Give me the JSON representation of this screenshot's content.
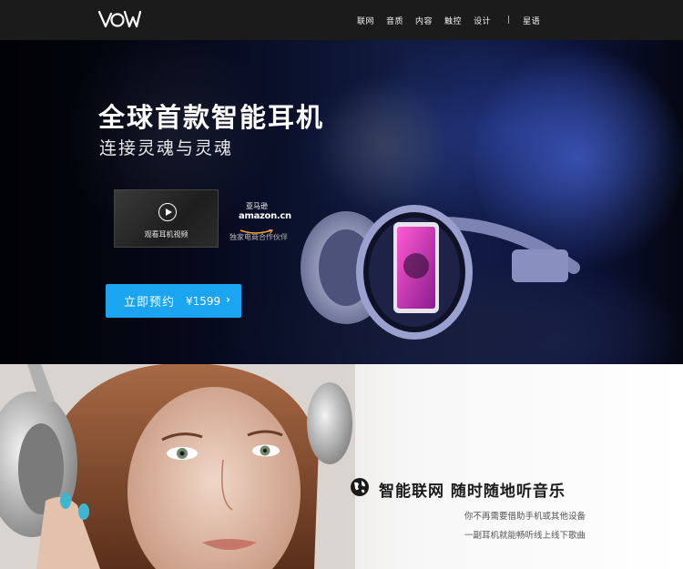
{
  "nav": {
    "logo": "VOW",
    "items": [
      "联网",
      "音质",
      "内容",
      "触控",
      "设计"
    ],
    "separator": "|",
    "extra": "星语"
  },
  "hero": {
    "title": "全球首款智能耳机",
    "subtitle": "连接灵魂与灵魂",
    "video_label": "观看耳机视频",
    "partner_logo_cn": "亚马逊",
    "partner_logo_en": "amazon.cn",
    "partner_text": "独家电商合作伙伴",
    "preorder_label": "立即预约",
    "preorder_price": "¥1599",
    "preorder_arrow": "›"
  },
  "feature": {
    "icon": "globe-icon",
    "title": "智能联网 随时随地听音乐",
    "line1": "你不再需要借助手机或其他设备",
    "line2": "一副耳机就能畅听线上线下歌曲"
  },
  "colors": {
    "nav_bg": "#1b1b1b",
    "accent": "#1ba4f0"
  }
}
